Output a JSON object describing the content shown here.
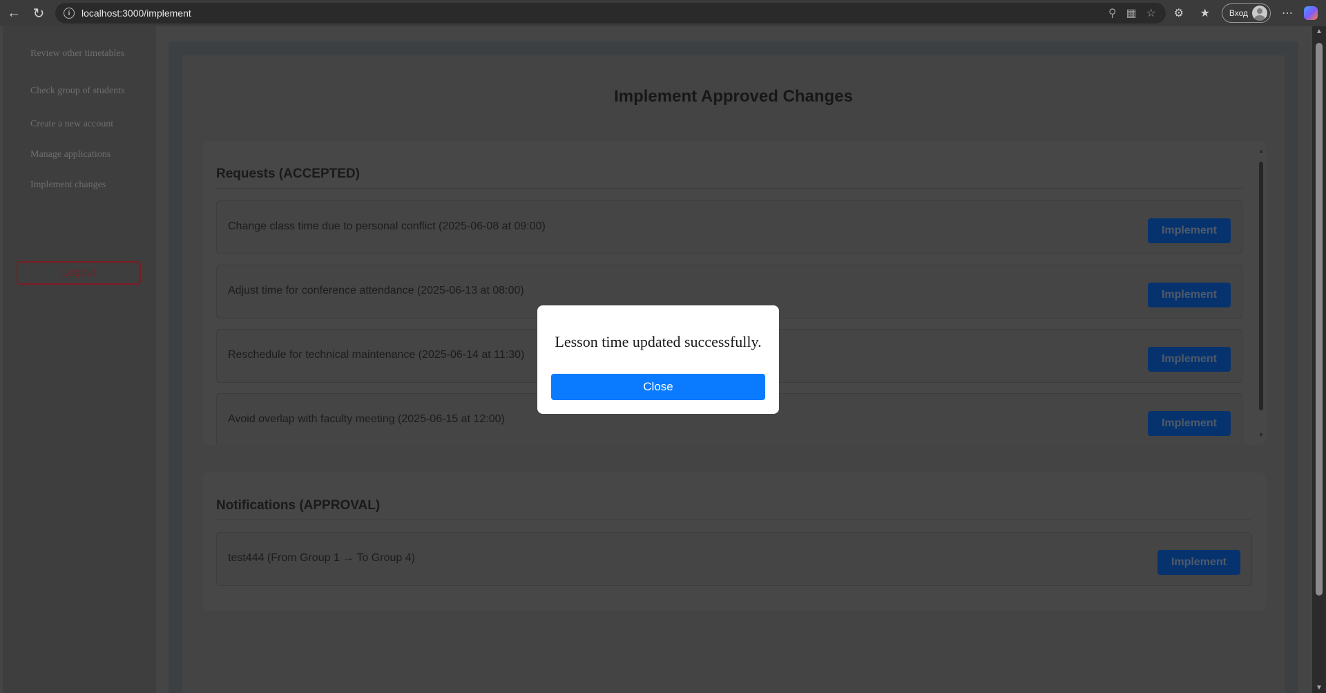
{
  "browser": {
    "url": "localhost:3000/implement",
    "signin_label": "Вход"
  },
  "sidebar": {
    "items": [
      {
        "label": "Review other timetables"
      },
      {
        "label": "Check group of students"
      },
      {
        "label": "Create a new account"
      },
      {
        "label": "Manage applications"
      },
      {
        "label": "Implement changes"
      }
    ],
    "logout_label": "Logout"
  },
  "main": {
    "title": "Implement Approved Changes",
    "requests": {
      "title": "Requests (ACCEPTED)",
      "items": [
        {
          "text": "Change class time due to personal conflict (2025-06-08 at 09:00)",
          "button": "Implement"
        },
        {
          "text": "Adjust time for conference attendance (2025-06-13 at 08:00)",
          "button": "Implement"
        },
        {
          "text": "Reschedule for technical maintenance (2025-06-14 at 11:30)",
          "button": "Implement"
        },
        {
          "text": "Avoid overlap with faculty meeting (2025-06-15 at 12:00)",
          "button": "Implement"
        }
      ]
    },
    "notifications": {
      "title": "Notifications (APPROVAL)",
      "items": [
        {
          "text": "test444 (From Group 1 → To Group 4)",
          "button": "Implement"
        }
      ]
    }
  },
  "modal": {
    "message": "Lesson time updated successfully.",
    "close_label": "Close"
  },
  "colors": {
    "accent": "#0a7bff",
    "implement_button": "#06336e",
    "logout_border": "#7d1c23"
  }
}
